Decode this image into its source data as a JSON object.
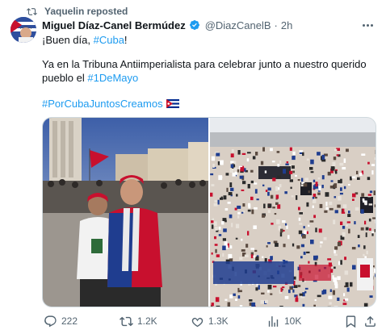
{
  "repost": {
    "text": "Yaquelin reposted",
    "icon": "repost-icon"
  },
  "author": {
    "name": "Miguel Díaz-Canel Bermúdez",
    "handle": "@DiazCanelB",
    "separator": "·",
    "time": "2h",
    "verified": true,
    "verified_color": "#1d9bf0"
  },
  "tweet": {
    "greeting_prefix": "¡Buen día, ",
    "greeting_tag": "#Cuba",
    "greeting_suffix": "!",
    "line2": "Ya en la Tribuna Antiimperialista para celebrar junto a nuestro querido",
    "line3_prefix": "pueblo el ",
    "line3_tag": "#1DeMayo",
    "hashtag_line": "#PorCubaJuntosCreamos",
    "flag": "🇨🇺"
  },
  "media": {
    "left_photo_icon": "couple-photo",
    "right_photo_icon": "crowd-photo"
  },
  "actions": {
    "replies": "222",
    "reposts": "1.2K",
    "likes": "1.3K",
    "views": "10K"
  },
  "colors": {
    "link": "#1d9bf0",
    "muted": "#536471",
    "text": "#0f1419"
  }
}
